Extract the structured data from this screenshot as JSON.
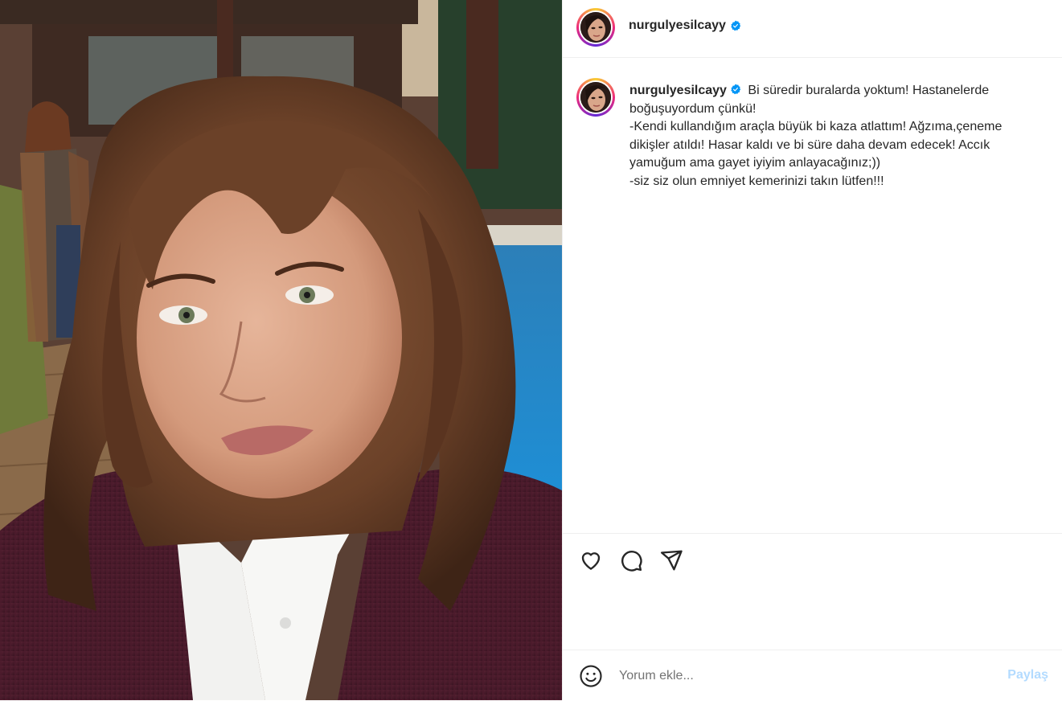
{
  "post": {
    "author": {
      "username": "nurgulyesilcayy",
      "verified": true
    },
    "caption": {
      "username": "nurgulyesilcayy",
      "lines": [
        "Bi süredir buralarda yoktum! Hastanelerde",
        "boğuşuyordum çünkü!",
        "-Kendi kullandığım araçla büyük bi kaza atlattım! Ağzıma,çeneme",
        "dikişler atıldı! Hasar kaldı ve bi süre daha devam edecek! Accık",
        "yamuğum ama gayet iyiyim anlayacağınız;))",
        "-siz siz olun emniyet kemerinizi takın lütfen!!!"
      ]
    },
    "actions": {
      "like_icon": "heart-icon",
      "comment_icon": "comment-bubble-icon",
      "share_icon": "paper-plane-icon"
    },
    "comment": {
      "placeholder": "Yorum ekle...",
      "value": "",
      "post_label": "Paylaş",
      "emoji_icon": "smiley-icon"
    },
    "colors": {
      "verified_badge": "#0095f6",
      "post_button_disabled": "#b3dbff",
      "divider": "#efefef"
    }
  }
}
